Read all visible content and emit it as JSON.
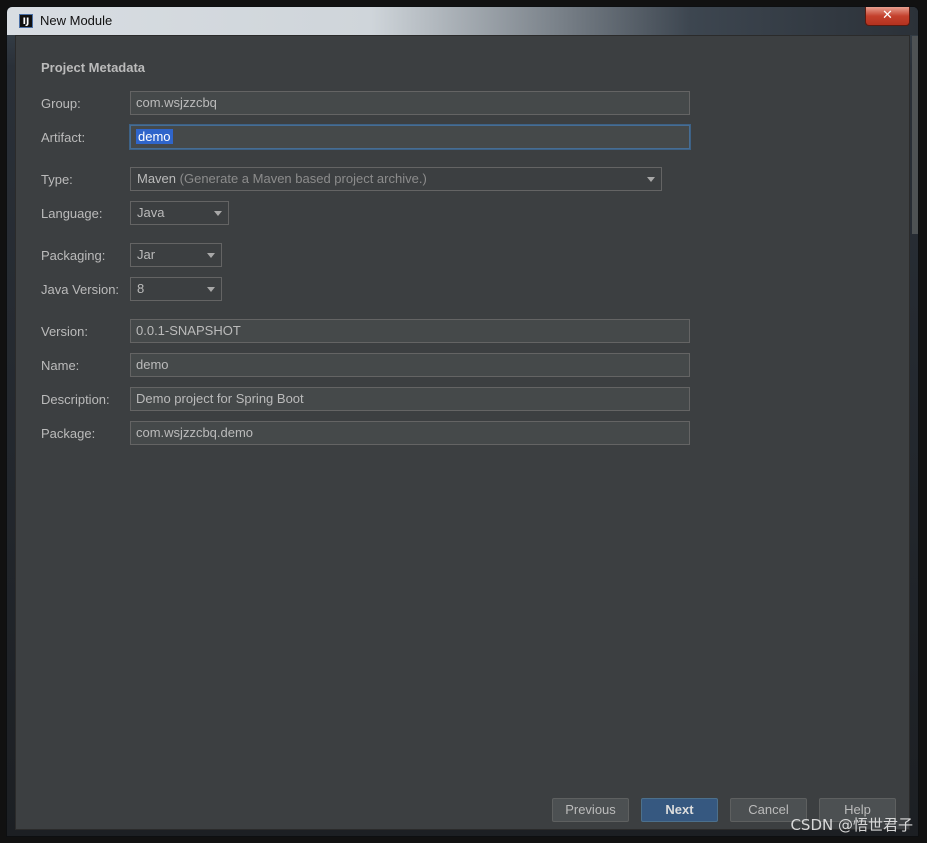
{
  "window": {
    "title": "New Module",
    "app_icon_text": "IJ",
    "close_glyph": "✕"
  },
  "section": {
    "title": "Project Metadata"
  },
  "fields": {
    "group": {
      "label": "Group:",
      "value": "com.wsjzzcbq"
    },
    "artifact": {
      "label": "Artifact:",
      "value": "demo"
    },
    "type": {
      "label": "Type:",
      "value": "Maven",
      "hint": "(Generate a Maven based project archive.)"
    },
    "language": {
      "label": "Language:",
      "value": "Java"
    },
    "packaging": {
      "label": "Packaging:",
      "value": "Jar"
    },
    "java_version": {
      "label": "Java Version:",
      "value": "8"
    },
    "version": {
      "label": "Version:",
      "value": "0.0.1-SNAPSHOT"
    },
    "name": {
      "label": "Name:",
      "value": "demo"
    },
    "description": {
      "label": "Description:",
      "value": "Demo project for Spring Boot"
    },
    "package": {
      "label": "Package:",
      "value": "com.wsjzzcbq.demo"
    }
  },
  "buttons": {
    "previous": "Previous",
    "next": "Next",
    "cancel": "Cancel",
    "help": "Help"
  },
  "watermark": "CSDN @悟世君子",
  "colors": {
    "background": "#3c3f41",
    "field": "#45494a",
    "primary_button": "#365880",
    "selection": "#2f65ca"
  }
}
